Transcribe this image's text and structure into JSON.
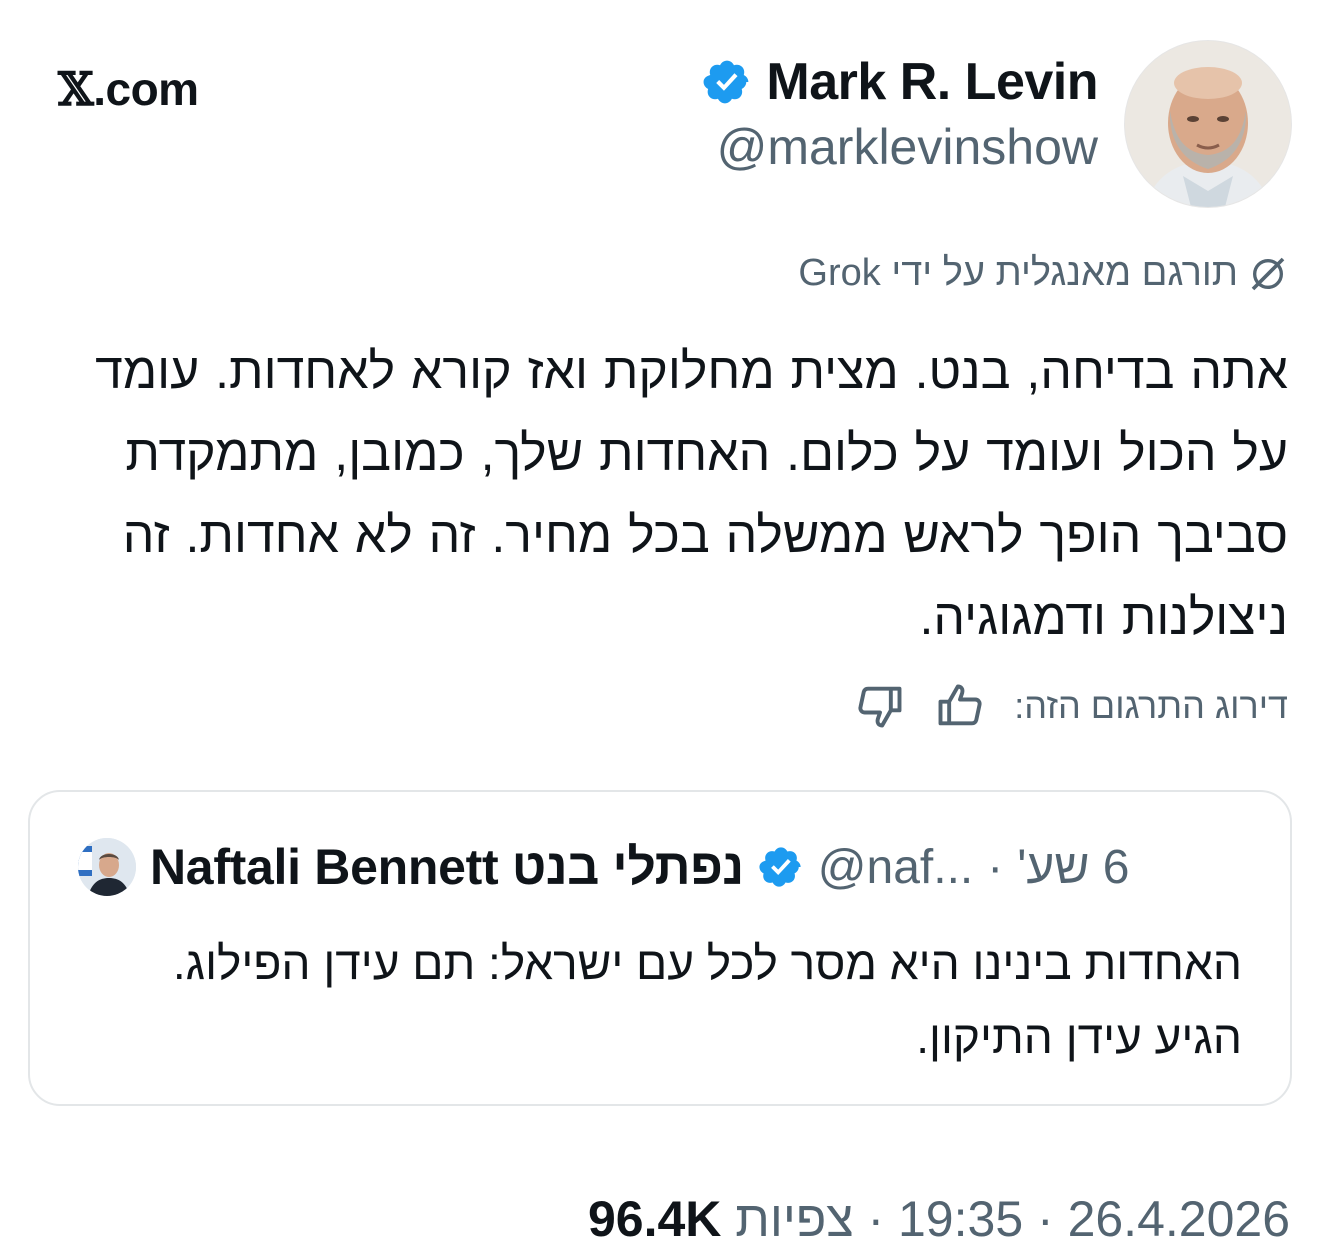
{
  "brand": {
    "mark": "𝕏",
    "domain": ".com"
  },
  "author": {
    "name": "Mark R. Levin",
    "handle": "@marklevinshow",
    "verified": true
  },
  "translation": {
    "label": "תורגם מאנגלית על ידי Grok",
    "icon": "grok-icon"
  },
  "tweet": {
    "text": "אתה בדיחה, בנט. מצית מחלוקת ואז קורא לאחדות. עומד על הכול ועומד על כלום. האחדות שלך, כמובן, מתמקדת סביבך הופך לראש ממשלה בכל מחיר. זה לא אחדות. זה ניצולנות ודמגוגיה."
  },
  "rating": {
    "label": "דירוג התרגום הזה:",
    "thumbs_up_icon": "thumbs-up-icon",
    "thumbs_down_icon": "thumbs-down-icon"
  },
  "quote": {
    "name": "Naftali Bennett נפתלי בנט",
    "handle": "@naf...",
    "separator": "·",
    "time": "6 שע'",
    "text": "האחדות בינינו היא מסר לכל עם ישראל: תם עידן הפילוג. הגיע עידן התיקון.",
    "verified": true
  },
  "footer": {
    "date": "26.4.2026",
    "sep1": " · ",
    "time": "19:35",
    "sep2": " · ",
    "views_label": "צפיות",
    "views_count": "96.4K"
  },
  "colors": {
    "text": "#0f1419",
    "secondary": "#536471",
    "verified_blue": "#1d9bf0",
    "border": "#e3e6e8"
  }
}
